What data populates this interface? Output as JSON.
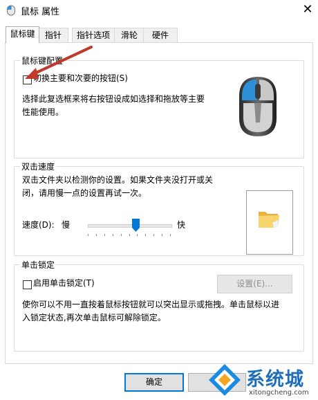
{
  "window": {
    "title": "鼠标 属性",
    "close_glyph": "✕"
  },
  "tabs": [
    {
      "label": "鼠标键",
      "active": true
    },
    {
      "label": "指针",
      "active": false
    },
    {
      "label": "指针选项",
      "active": false
    },
    {
      "label": "滑轮",
      "active": false
    },
    {
      "label": "硬件",
      "active": false
    }
  ],
  "button_config": {
    "group_title": "鼠标键配置",
    "swap_checkbox_label": "切换主要和次要的按钮(S)",
    "swap_checked": false,
    "description_line1": "选择此复选框来将右按钮设成如选择和拖放等主要",
    "description_line2": "性能使用。"
  },
  "double_click": {
    "group_title": "双击速度",
    "description_line1": "双击文件夹以检测你的设置。如果文件夹没打开或关",
    "description_line2": "闭，请用慢一点的设置再试一次。",
    "speed_label": "速度(D):",
    "slow_label": "慢",
    "fast_label": "快",
    "speed_level_fraction": 0.58
  },
  "click_lock": {
    "group_title": "单击锁定",
    "checkbox_label": "启用单击锁定(T)",
    "checked": false,
    "settings_button_label": "设置(E)...",
    "description_line1": "使你可以不用一直按着鼠标按钮就可以突出显示或拖拽。单击鼠标以进",
    "description_line2": "入锁定状态,再次单击鼠标可解除锁定。"
  },
  "footer": {
    "ok_label": "确定",
    "cancel_label_partial": "取"
  },
  "watermark": {
    "brand": "系统城",
    "url": "xitongcheng.com"
  },
  "colors": {
    "accent": "#0078d7",
    "arrow": "#c0392b",
    "folder": "#f5c74e",
    "mouse_blue": "#2c8fd8"
  }
}
